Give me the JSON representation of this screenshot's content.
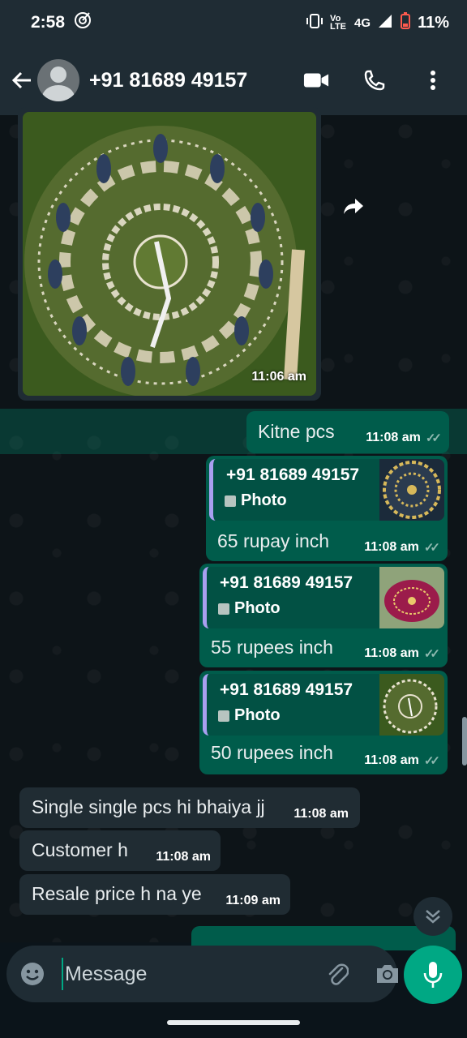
{
  "status_bar": {
    "time": "2:58",
    "network": "4G",
    "volte_label": "Vo LTE",
    "battery_percent": "11%"
  },
  "header": {
    "contact_name": "+91 81689 49157",
    "icons": [
      "back-arrow-icon",
      "avatar",
      "video-call-icon",
      "phone-call-icon",
      "more-vert-icon"
    ]
  },
  "messages": {
    "image": {
      "time": "11:06 am"
    },
    "kitne": {
      "text": "Kitne pcs",
      "time": "11:08 am"
    },
    "reply1": {
      "quote_name": "+91 81689 49157",
      "quote_type": "Photo",
      "text": "65 rupay inch",
      "time": "11:08 am"
    },
    "reply2": {
      "quote_name": "+91 81689 49157",
      "quote_type": "Photo",
      "text": "55 rupees inch",
      "time": "11:08 am"
    },
    "reply3": {
      "quote_name": "+91 81689 49157",
      "quote_type": "Photo",
      "text": "50 rupees inch",
      "time": "11:08 am"
    },
    "in1": {
      "text": "Single single pcs hi bhaiya jj",
      "time": "11:08 am"
    },
    "in2": {
      "text": "Customer h",
      "time": "11:08 am"
    },
    "in3": {
      "text": "Resale price h na ye",
      "time": "11:09 am"
    }
  },
  "composer": {
    "placeholder": "Message"
  },
  "colors": {
    "header_bg": "#1f2c34",
    "outgoing_bubble": "#005c4b",
    "incoming_bubble": "#202c33",
    "accent": "#00a884",
    "quote_bar": "#a99ff0"
  }
}
